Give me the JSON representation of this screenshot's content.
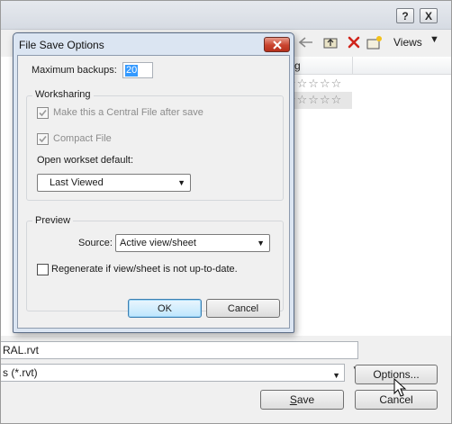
{
  "parent": {
    "title_buttons": {
      "help": "?",
      "close": "X"
    },
    "toolbar": {
      "views_label": "Views"
    },
    "column_header": "g",
    "filename_value": "RAL.rvt",
    "filetype_value": "s  (*.rvt)",
    "options_label": "Options...",
    "save_label": "Save",
    "save_accel": "S",
    "cancel_label": "Cancel"
  },
  "dialog": {
    "title": "File Save Options",
    "max_backups_label": "Maximum backups:",
    "max_backups_value": "20",
    "worksharing": {
      "legend": "Worksharing",
      "central_file_label": "Make this a Central File after save",
      "compact_file_label": "Compact File",
      "workset_default_label": "Open workset default:",
      "workset_default_value": "Last Viewed"
    },
    "preview": {
      "legend": "Preview",
      "source_label": "Source:",
      "source_value": "Active view/sheet",
      "regenerate_label": "Regenerate if view/sheet is not up-to-date."
    },
    "ok_label": "OK",
    "cancel_label": "Cancel"
  },
  "stars": "☆☆☆☆☆"
}
